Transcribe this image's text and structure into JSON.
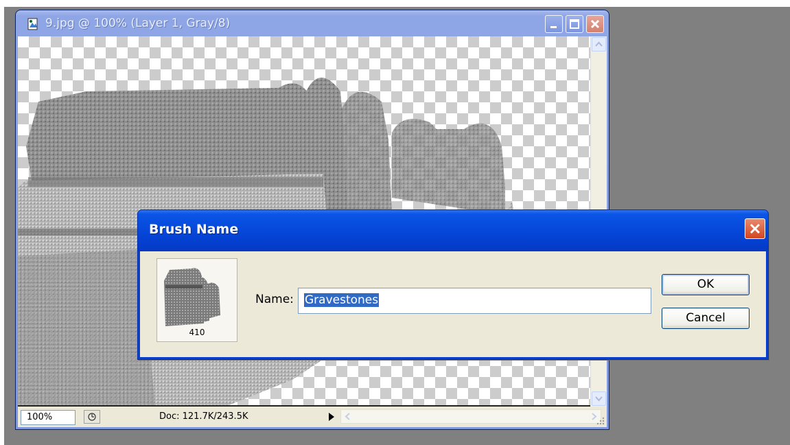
{
  "document_window": {
    "title": "9.jpg @ 100% (Layer 1, Gray/8)",
    "icons": [
      "photoshop-doc-icon",
      "minimize-icon",
      "maximize-icon",
      "close-icon"
    ],
    "status": {
      "zoom": "100%",
      "doc_info": "Doc: 121.7K/243.5K"
    }
  },
  "dialog": {
    "title": "Brush Name",
    "brush_preview_count": "410",
    "name_label": "Name:",
    "name_value": "Gravestones",
    "ok_label": "OK",
    "cancel_label": "Cancel"
  },
  "colors": {
    "workspace": "#808080",
    "xp_title_blue": "#0a55e6",
    "selection": "#316ac5",
    "dialog_face": "#ece9d8"
  }
}
